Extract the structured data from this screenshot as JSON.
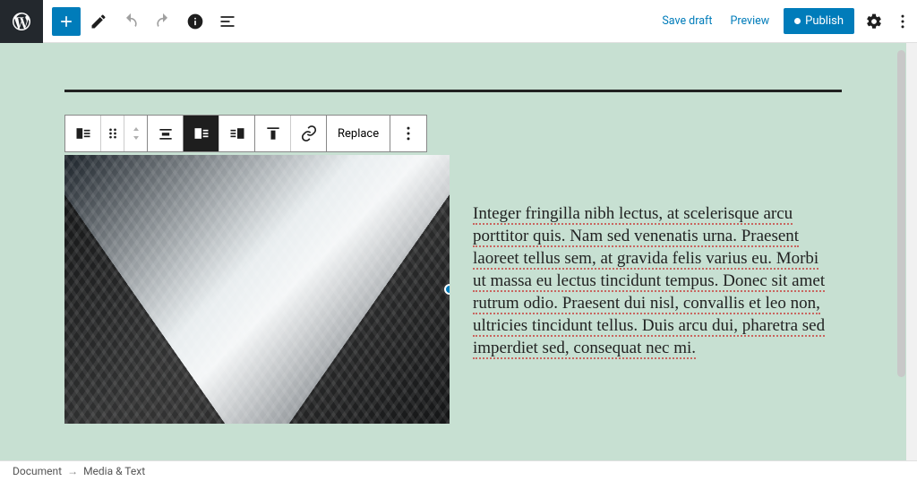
{
  "topbar": {
    "save_draft": "Save draft",
    "preview": "Preview",
    "publish": "Publish"
  },
  "block_toolbar": {
    "replace": "Replace"
  },
  "content": {
    "paragraph": "Integer fringilla nibh lectus, at scelerisque arcu porttitor quis. Nam sed venenatis urna. Praesent laoreet tellus sem, at gravida felis varius eu. Morbi ut massa eu lectus tincidunt tempus. Donec sit amet rutrum odio. Praesent dui nisl, convallis et leo non, ultricies tincidunt tellus. Duis arcu dui, pharetra sed imperdiet sed, consequat nec mi."
  },
  "breadcrumb": {
    "root": "Document",
    "current": "Media & Text"
  }
}
